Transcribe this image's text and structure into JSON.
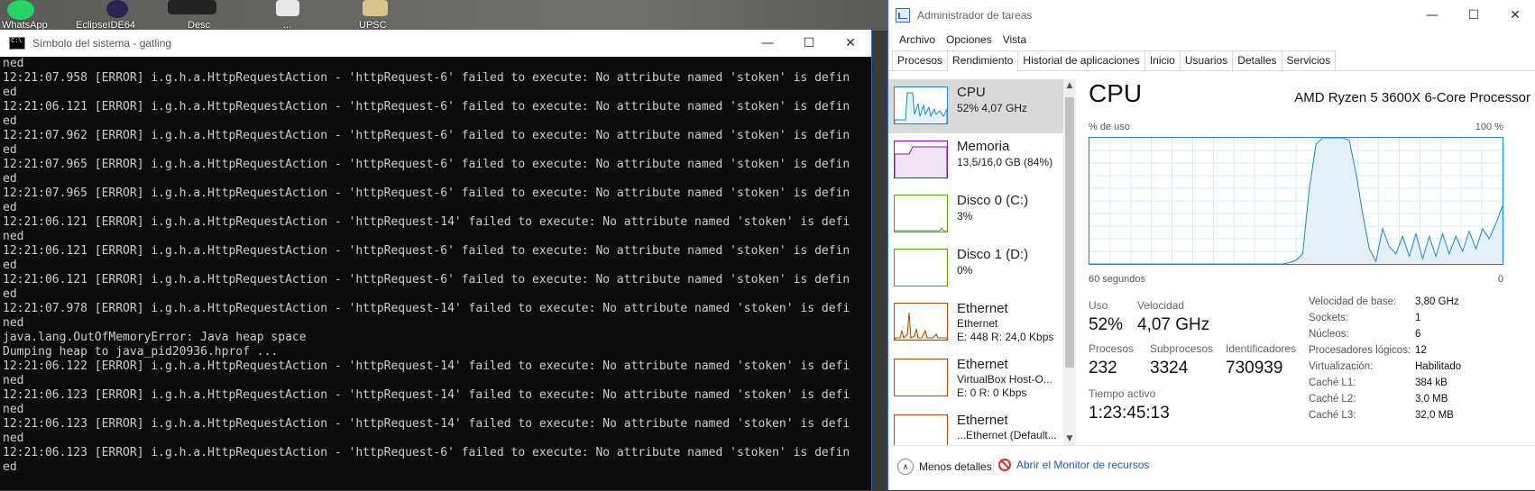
{
  "desktop": {
    "icons": [
      {
        "label": "WhatsApp"
      },
      {
        "label": "EclipseIDE64"
      },
      {
        "label": "Desc"
      },
      {
        "label": "..."
      },
      {
        "label": "UPSC"
      }
    ]
  },
  "cmd": {
    "title": "Símbolo del sistema - gatling",
    "lines": [
      "ned",
      "12:21:07.958 [ERROR] i.g.h.a.HttpRequestAction - 'httpRequest-6' failed to execute: No attribute named 'stoken' is defin",
      "ed",
      "12:21:06.121 [ERROR] i.g.h.a.HttpRequestAction - 'httpRequest-6' failed to execute: No attribute named 'stoken' is defin",
      "ed",
      "12:21:07.962 [ERROR] i.g.h.a.HttpRequestAction - 'httpRequest-6' failed to execute: No attribute named 'stoken' is defin",
      "ed",
      "12:21:07.965 [ERROR] i.g.h.a.HttpRequestAction - 'httpRequest-6' failed to execute: No attribute named 'stoken' is defin",
      "ed",
      "12:21:07.965 [ERROR] i.g.h.a.HttpRequestAction - 'httpRequest-6' failed to execute: No attribute named 'stoken' is defin",
      "ed",
      "12:21:06.121 [ERROR] i.g.h.a.HttpRequestAction - 'httpRequest-14' failed to execute: No attribute named 'stoken' is defi",
      "ned",
      "12:21:06.121 [ERROR] i.g.h.a.HttpRequestAction - 'httpRequest-6' failed to execute: No attribute named 'stoken' is defin",
      "ed",
      "12:21:06.121 [ERROR] i.g.h.a.HttpRequestAction - 'httpRequest-6' failed to execute: No attribute named 'stoken' is defin",
      "ed",
      "12:21:07.978 [ERROR] i.g.h.a.HttpRequestAction - 'httpRequest-14' failed to execute: No attribute named 'stoken' is defi",
      "ned",
      "java.lang.OutOfMemoryError: Java heap space",
      "Dumping heap to java_pid20936.hprof ...",
      "12:21:06.122 [ERROR] i.g.h.a.HttpRequestAction - 'httpRequest-14' failed to execute: No attribute named 'stoken' is defi",
      "ned",
      "12:21:06.123 [ERROR] i.g.h.a.HttpRequestAction - 'httpRequest-14' failed to execute: No attribute named 'stoken' is defi",
      "ned",
      "12:21:06.123 [ERROR] i.g.h.a.HttpRequestAction - 'httpRequest-14' failed to execute: No attribute named 'stoken' is defi",
      "ned",
      "12:21:06.123 [ERROR] i.g.h.a.HttpRequestAction - 'httpRequest-6' failed to execute: No attribute named 'stoken' is defin",
      "ed"
    ]
  },
  "tm": {
    "title": "Administrador de tareas",
    "menu": [
      "Archivo",
      "Opciones",
      "Vista"
    ],
    "tabs": [
      "Procesos",
      "Rendimiento",
      "Historial de aplicaciones",
      "Inicio",
      "Usuarios",
      "Detalles",
      "Servicios"
    ],
    "active_tab": "Rendimiento",
    "resources": [
      {
        "name": "CPU",
        "sub": "52% 4,07 GHz",
        "sub2": ""
      },
      {
        "name": "Memoria",
        "sub": "13,5/16,0 GB (84%)",
        "sub2": ""
      },
      {
        "name": "Disco 0 (C:)",
        "sub": "3%",
        "sub2": ""
      },
      {
        "name": "Disco 1 (D:)",
        "sub": "0%",
        "sub2": ""
      },
      {
        "name": "Ethernet",
        "sub": "Ethernet",
        "sub2": "E: 448 R: 24,0 Kbps"
      },
      {
        "name": "Ethernet",
        "sub": "VirtualBox Host-O...",
        "sub2": "E: 0 R: 0 Kbps"
      },
      {
        "name": "Ethernet",
        "sub": "...Ethernet (Default...",
        "sub2": ""
      }
    ],
    "panel": {
      "title": "CPU",
      "processor": "AMD Ryzen 5 3600X 6-Core Processor",
      "axis_label": "% de uso",
      "axis_max": "100 %",
      "axis_time": "60 segundos",
      "axis_min": "0",
      "uso_label": "Uso",
      "uso_val": "52%",
      "vel_label": "Velocidad",
      "vel_val": "4,07 GHz",
      "proc_label": "Procesos",
      "proc_val": "232",
      "sub_label": "Subprocesos",
      "sub_val": "3324",
      "id_label": "Identificadores",
      "id_val": "730939",
      "uptime_label": "Tiempo activo",
      "uptime_val": "1:23:45:13",
      "details": [
        {
          "k": "Velocidad de base:",
          "v": "3,80 GHz"
        },
        {
          "k": "Sockets:",
          "v": "1"
        },
        {
          "k": "Núcleos:",
          "v": "6"
        },
        {
          "k": "Procesadores lógicos:",
          "v": "12"
        },
        {
          "k": "Virtualización:",
          "v": "Habilitado"
        },
        {
          "k": "Caché L1:",
          "v": "384 kB"
        },
        {
          "k": "Caché L2:",
          "v": "3,0 MB"
        },
        {
          "k": "Caché L3:",
          "v": "32,0 MB"
        }
      ]
    },
    "footer": {
      "less": "Menos detalles",
      "monitor": "Abrir el Monitor de recursos"
    }
  },
  "colors": {
    "accent": "#1f87cc",
    "memory": "#8b12ae",
    "disk": "#4da60c",
    "ethernet": "#a74f01"
  },
  "cpu_usage_history": [
    0,
    0,
    0,
    0,
    0,
    0,
    0,
    0,
    0,
    0,
    0,
    0,
    0,
    0,
    0,
    0,
    0,
    0,
    0,
    0,
    0,
    0,
    0,
    0,
    0,
    0,
    0,
    0,
    0,
    0,
    1,
    3,
    8,
    60,
    95,
    100,
    100,
    100,
    100,
    98,
    72,
    40,
    12,
    2,
    28,
    14,
    8,
    22,
    6,
    24,
    4,
    22,
    6,
    24,
    8,
    22,
    10,
    26,
    12,
    28,
    20,
    32,
    46
  ]
}
